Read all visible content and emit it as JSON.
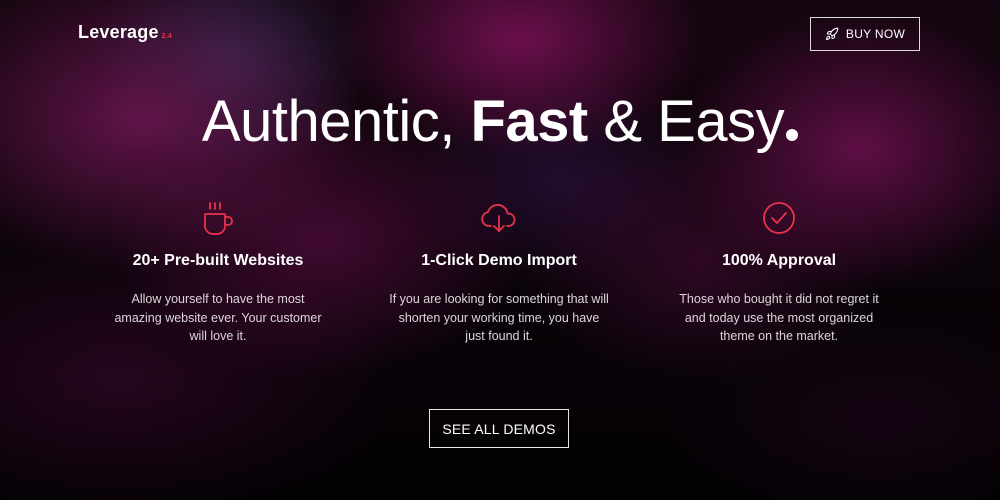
{
  "header": {
    "logo_text": "Leverage",
    "logo_version": "2.4",
    "buy_button_label": "BUY NOW"
  },
  "hero": {
    "headline_part1": "Authentic, ",
    "headline_bold": "Fast",
    "headline_part2": " & Easy"
  },
  "features": [
    {
      "icon": "coffee-cup-icon",
      "title": "20+ Pre-built Websites",
      "description": "Allow yourself to have the most amazing website ever. Your customer will love it."
    },
    {
      "icon": "cloud-download-icon",
      "title": "1-Click Demo Import",
      "description": "If you are looking for something that will shorten your working time, you have just found it."
    },
    {
      "icon": "check-circle-icon",
      "title": "100% Approval",
      "description": "Those who bought it did not regret it and today use the most organized theme on the market."
    }
  ],
  "cta": {
    "demos_button_label": "SEE ALL DEMOS"
  },
  "colors": {
    "accent": "#e8334a",
    "text": "#ffffff",
    "background": "#0c040b"
  }
}
